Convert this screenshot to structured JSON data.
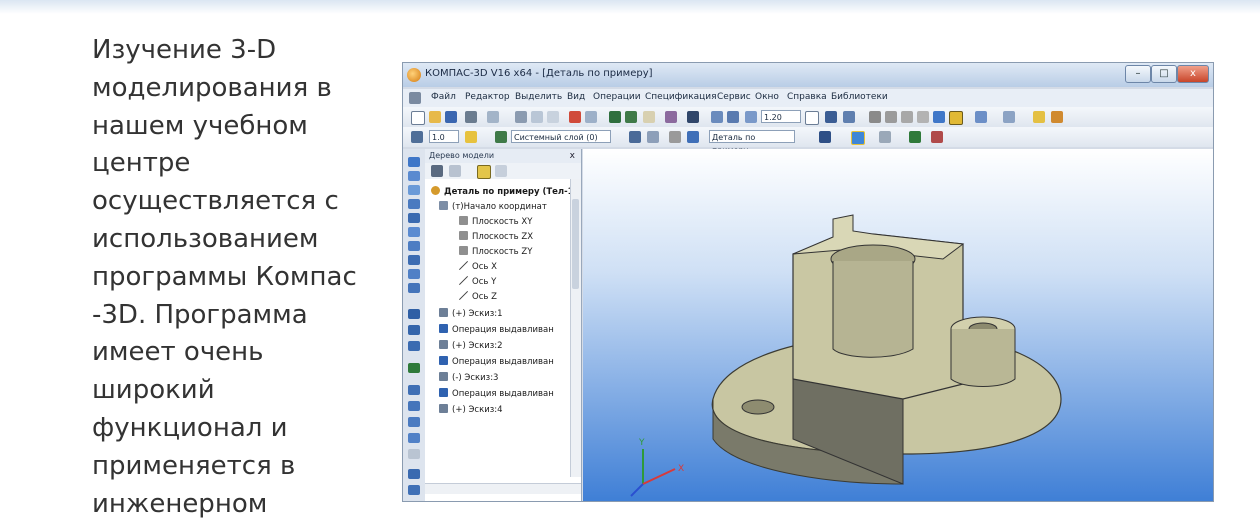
{
  "slide": {
    "paragraph": "Изучение 3-D\nмоделирования в\nнашем учебном\nцентре\nосуществляется с\nиспользованием\nпрограммы Компас\n-3D. Программа\nимеет очень\nширокий\nфункционал и\nприменяется в\nинженерном"
  },
  "window": {
    "title": "КОМПАС-3D V16  x64 - [Деталь по примеру]",
    "minimize": "–",
    "maximize": "□",
    "close": "x"
  },
  "menu": [
    "Файл",
    "Редактор",
    "Выделить",
    "Вид",
    "Операции",
    "Спецификация",
    "Сервис",
    "Окно",
    "Справка",
    "Библиотеки"
  ],
  "toolbar": {
    "zoom_value": "1.20",
    "step_value": "1.0",
    "layer_value": "Системный слой (0)",
    "detail_value": "Деталь по примеру"
  },
  "tree": {
    "header": "Дерево модели",
    "close": "x",
    "items": [
      "Деталь по примеру (Тел-1",
      "(т)Начало координат",
      "Плоскость XY",
      "Плоскость ZX",
      "Плоскость ZY",
      "Ось X",
      "Ось Y",
      "Ось Z",
      "(+) Эскиз:1",
      "Операция выдавливан",
      "(+) Эскиз:2",
      "Операция выдавливан",
      "(-) Эскиз:3",
      "Операция выдавливан",
      "(+) Эскиз:4"
    ]
  },
  "axes": {
    "x": "X",
    "y": "Y"
  },
  "colors": {
    "part_face": "#c9c7a3",
    "part_shadow": "#6f6f62",
    "viewport_bottom": "#3f7fd6"
  }
}
